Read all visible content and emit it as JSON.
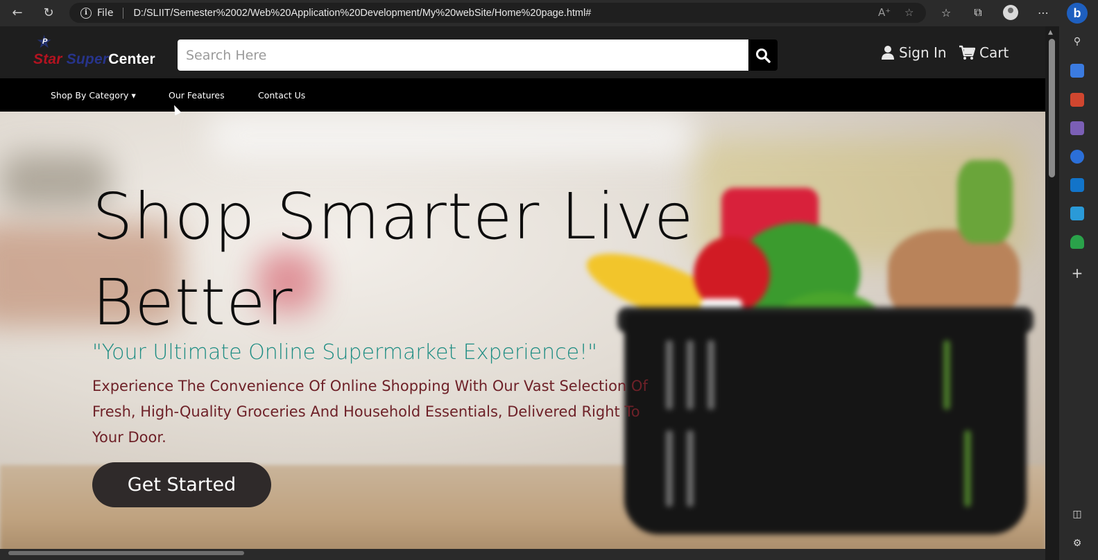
{
  "browser": {
    "address_prefix": "File",
    "url": "D:/SLIIT/Semester%2002/Web%20Application%20Development/My%20webSite/Home%20page.html#",
    "back_icon": "back-arrow-icon",
    "refresh_icon": "refresh-icon"
  },
  "header": {
    "logo": {
      "word1": "Star ",
      "word2": "Super",
      "word3": "Center",
      "badge": "P"
    },
    "search": {
      "placeholder": "Search Here"
    },
    "sign_in": "Sign In",
    "cart": "Cart"
  },
  "nav": {
    "items": [
      {
        "label": "Shop By Category"
      },
      {
        "label": "Our Features"
      },
      {
        "label": "Contact Us"
      }
    ]
  },
  "hero": {
    "title": "Shop Smarter Live Better",
    "tagline": "\"Your Ultimate Online Supermarket Experience!\"",
    "description": "Experience The Convenience Of Online Shopping With Our Vast Selection Of Fresh, High-Quality Groceries And Household Essentials, Delivered Right To Your Door.",
    "cta": "Get Started"
  },
  "colors": {
    "tagline": "#1c8c82",
    "description": "#6e2128",
    "cta_bg": "#2f2a2a",
    "header_bg": "#1e1e1e",
    "nav_bg": "#000000"
  }
}
